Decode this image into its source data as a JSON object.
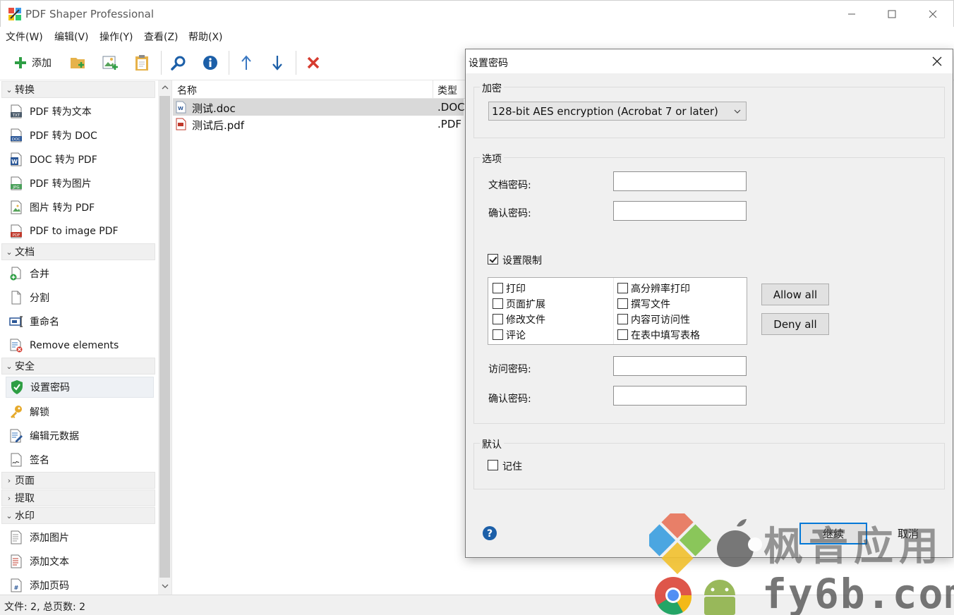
{
  "app": {
    "title": "PDF Shaper Professional"
  },
  "menu": [
    {
      "label": "文件(W)"
    },
    {
      "label": "编辑(V)"
    },
    {
      "label": "操作(Y)"
    },
    {
      "label": "查看(Z)"
    },
    {
      "label": "帮助(X)"
    }
  ],
  "toolbar": {
    "add_label": "添加",
    "icons": [
      "add-icon",
      "add-folder-icon",
      "add-image-icon",
      "clipboard-icon",
      "search-icon",
      "info-icon",
      "move-up-icon",
      "move-down-icon",
      "remove-icon"
    ],
    "colors": {
      "add": "#2e9e44",
      "folder": "#e6b24a",
      "search": "#1c5fa8",
      "info": "#1c5fa8",
      "arrow": "#3a78c2",
      "remove": "#d63b2f"
    }
  },
  "sidebar": {
    "sections": [
      {
        "label": "转换",
        "expanded": true,
        "items": [
          {
            "label": "PDF 转为文本",
            "icon": "txt-file-icon"
          },
          {
            "label": "PDF 转为 DOC",
            "icon": "doc-file-icon"
          },
          {
            "label": "DOC 转为 PDF",
            "icon": "word-file-icon"
          },
          {
            "label": "PDF 转为图片",
            "icon": "jpg-file-icon"
          },
          {
            "label": "图片 转为 PDF",
            "icon": "image-file-icon"
          },
          {
            "label": "PDF to image PDF",
            "icon": "pdf-file-icon"
          }
        ]
      },
      {
        "label": "文档",
        "expanded": true,
        "items": [
          {
            "label": "合并",
            "icon": "merge-icon"
          },
          {
            "label": "分割",
            "icon": "split-icon"
          },
          {
            "label": "重命名",
            "icon": "rename-icon"
          },
          {
            "label": "Remove elements",
            "icon": "remove-elements-icon"
          }
        ]
      },
      {
        "label": "安全",
        "expanded": true,
        "items": [
          {
            "label": "设置密码",
            "icon": "shield-icon",
            "selected": true
          },
          {
            "label": "解锁",
            "icon": "key-icon"
          },
          {
            "label": "编辑元数据",
            "icon": "edit-metadata-icon"
          },
          {
            "label": "签名",
            "icon": "signature-icon"
          }
        ]
      },
      {
        "label": "页面",
        "expanded": false,
        "items": []
      },
      {
        "label": "提取",
        "expanded": false,
        "items": []
      },
      {
        "label": "水印",
        "expanded": true,
        "items": [
          {
            "label": "添加图片",
            "icon": "add-image-doc-icon"
          },
          {
            "label": "添加文本",
            "icon": "add-text-doc-icon"
          },
          {
            "label": "添加页码",
            "icon": "page-number-icon"
          }
        ]
      }
    ]
  },
  "filelist": {
    "columns": [
      "名称",
      "类型"
    ],
    "rows": [
      {
        "name": "测试.doc",
        "type": ".DOC",
        "icon": "word-doc-icon",
        "selected": true
      },
      {
        "name": "测试后.pdf",
        "type": ".PDF",
        "icon": "pdf-doc-icon",
        "selected": false
      }
    ]
  },
  "status": {
    "text": "文件: 2, 总页数: 2"
  },
  "dialog": {
    "title": "设置密码",
    "encryption": {
      "group_label": "加密",
      "selected": "128-bit AES encryption (Acrobat 7 or later)"
    },
    "options": {
      "group_label": "选项",
      "doc_password_label": "文档密码:",
      "confirm_password_label": "确认密码:",
      "doc_password_value": "",
      "confirm_password_value": "",
      "restrict_label": "设置限制",
      "restrict_checked": true,
      "permissions_left": [
        {
          "label": "打印",
          "checked": false
        },
        {
          "label": "页面扩展",
          "checked": false
        },
        {
          "label": "修改文件",
          "checked": false
        },
        {
          "label": "评论",
          "checked": false
        }
      ],
      "permissions_right": [
        {
          "label": "高分辨率打印",
          "checked": false
        },
        {
          "label": "撰写文件",
          "checked": false
        },
        {
          "label": "内容可访问性",
          "checked": false
        },
        {
          "label": "在表中填写表格",
          "checked": false
        }
      ],
      "allow_all_label": "Allow all",
      "deny_all_label": "Deny all",
      "access_password_label": "访问密码:",
      "access_confirm_label": "确认密码:",
      "access_password_value": "",
      "access_confirm_value": ""
    },
    "defaults": {
      "group_label": "默认",
      "remember_label": "记住",
      "remember_checked": false
    },
    "continue_label": "继续",
    "cancel_label": "取消"
  },
  "watermark": {
    "top_text": "枫音应用",
    "bottom_text": "fy6b.com"
  }
}
